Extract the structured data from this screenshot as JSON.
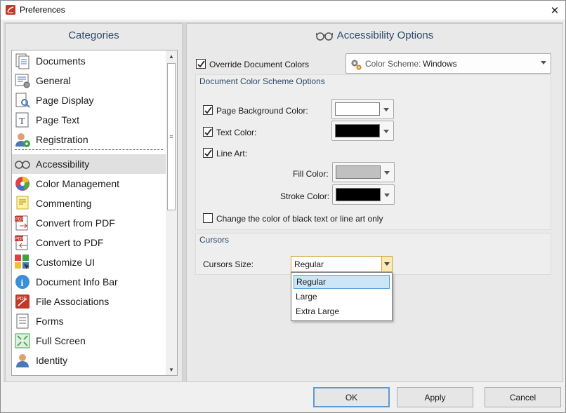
{
  "window": {
    "title": "Preferences",
    "close_glyph": "✕",
    "app_icon": "pdf-app-icon"
  },
  "categories": {
    "header": "Categories",
    "items": [
      {
        "label": "Documents",
        "icon": "documents-icon"
      },
      {
        "label": "General",
        "icon": "general-icon"
      },
      {
        "label": "Page Display",
        "icon": "page-display-icon"
      },
      {
        "label": "Page Text",
        "icon": "page-text-icon"
      },
      {
        "label": "Registration",
        "icon": "registration-icon"
      },
      {
        "label": "Accessibility",
        "icon": "glasses-icon",
        "selected": true
      },
      {
        "label": "Color Management",
        "icon": "color-management-icon"
      },
      {
        "label": "Commenting",
        "icon": "commenting-icon"
      },
      {
        "label": "Convert from PDF",
        "icon": "convert-from-pdf-icon"
      },
      {
        "label": "Convert to PDF",
        "icon": "convert-to-pdf-icon"
      },
      {
        "label": "Customize UI",
        "icon": "customize-ui-icon"
      },
      {
        "label": "Document Info Bar",
        "icon": "info-icon"
      },
      {
        "label": "File Associations",
        "icon": "file-associations-icon"
      },
      {
        "label": "Forms",
        "icon": "forms-icon"
      },
      {
        "label": "Full Screen",
        "icon": "full-screen-icon"
      },
      {
        "label": "Identity",
        "icon": "identity-icon"
      }
    ],
    "scroll_grip": "≡"
  },
  "options": {
    "header": "Accessibility Options",
    "override": {
      "label": "Override Document Colors",
      "checked": true
    },
    "color_scheme": {
      "label": "Color Scheme:",
      "value": "Windows"
    },
    "scheme_group": {
      "title": "Document Color Scheme Options",
      "page_bg": {
        "label": "Page Background Color:",
        "checked": true,
        "color": "#ffffff"
      },
      "text_color": {
        "label": "Text Color:",
        "checked": true,
        "color": "#000000"
      },
      "line_art": {
        "label": "Line Art:",
        "checked": true
      },
      "fill_color": {
        "label": "Fill Color:",
        "color": "#c0c0c0"
      },
      "stroke_color": {
        "label": "Stroke Color:",
        "color": "#000000"
      },
      "black_only": {
        "label": "Change the color of black text or line art only",
        "checked": false
      }
    },
    "cursors_group": {
      "title": "Cursors",
      "size_label": "Cursors Size:",
      "size_value": "Regular",
      "options": [
        "Regular",
        "Large",
        "Extra Large"
      ],
      "highlighted": "Regular"
    }
  },
  "buttons": {
    "ok": "OK",
    "apply": "Apply",
    "cancel": "Cancel"
  },
  "colors": {
    "header_text": "#2d4a6b",
    "selection": "#cde6f7",
    "focus_border": "#5b9bd5"
  }
}
